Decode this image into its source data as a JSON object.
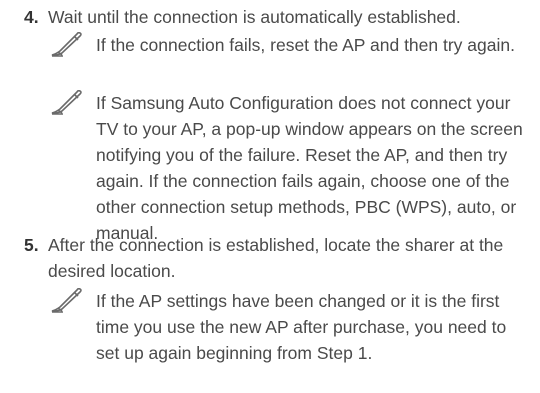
{
  "steps": [
    {
      "number": "4.",
      "text": "Wait until the connection is automatically established.",
      "notes": [
        {
          "icon": "pencil-note-icon",
          "text": "If the connection fails, reset the AP and then try again."
        },
        {
          "icon": "pencil-note-icon",
          "text": "If Samsung Auto Configuration does not connect your TV to your AP, a pop-up window appears on the screen notifying you of the failure. Reset the AP, and then try again. If the connection fails again, choose one of the other connection setup methods, PBC (WPS), auto, or manual."
        }
      ]
    },
    {
      "number": "5.",
      "text": "After the connection is established, locate the sharer at the desired location.",
      "notes": [
        {
          "icon": "pencil-note-icon",
          "text": "If the AP settings have been changed or it is the first time you use the new AP after purchase, you need to set up again beginning from Step 1."
        }
      ]
    }
  ]
}
